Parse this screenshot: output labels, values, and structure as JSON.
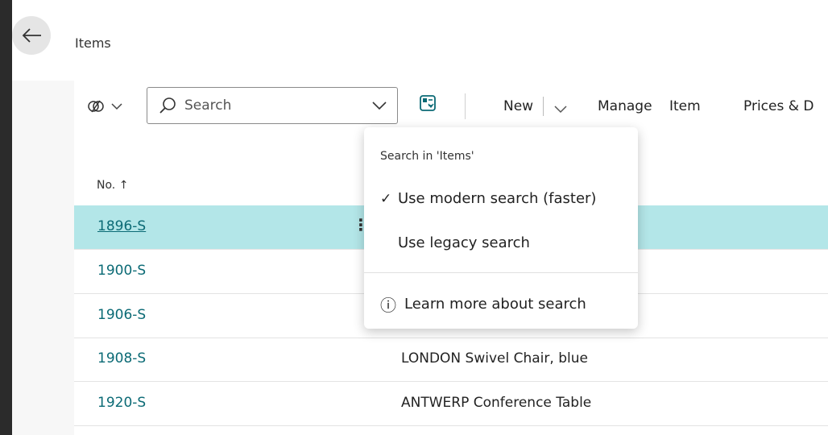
{
  "header": {
    "title": "Items"
  },
  "toolbar": {
    "search_placeholder": "Search",
    "new_label": "New",
    "manage_label": "Manage",
    "item_label": "Item",
    "prices_label": "Prices & D"
  },
  "list": {
    "columns": {
      "no": "No. ↑"
    },
    "rows": [
      {
        "no": "1896-S",
        "description": ""
      },
      {
        "no": "1900-S",
        "description": ""
      },
      {
        "no": "1906-S",
        "description": ""
      },
      {
        "no": "1908-S",
        "description": "LONDON Swivel Chair, blue"
      },
      {
        "no": "1920-S",
        "description": "ANTWERP Conference Table"
      }
    ],
    "selected_row_menu": "⋮"
  },
  "search_menu": {
    "title": "Search in 'Items'",
    "modern": "Use modern search (faster)",
    "legacy": "Use legacy search",
    "learn_more": "Learn more about search",
    "check_glyph": "✓",
    "info_glyph": "ⓘ"
  },
  "colors": {
    "accent_link": "#0b6a75",
    "selected_row": "#b3e6e8",
    "frame_border": "#2b2b2b"
  }
}
